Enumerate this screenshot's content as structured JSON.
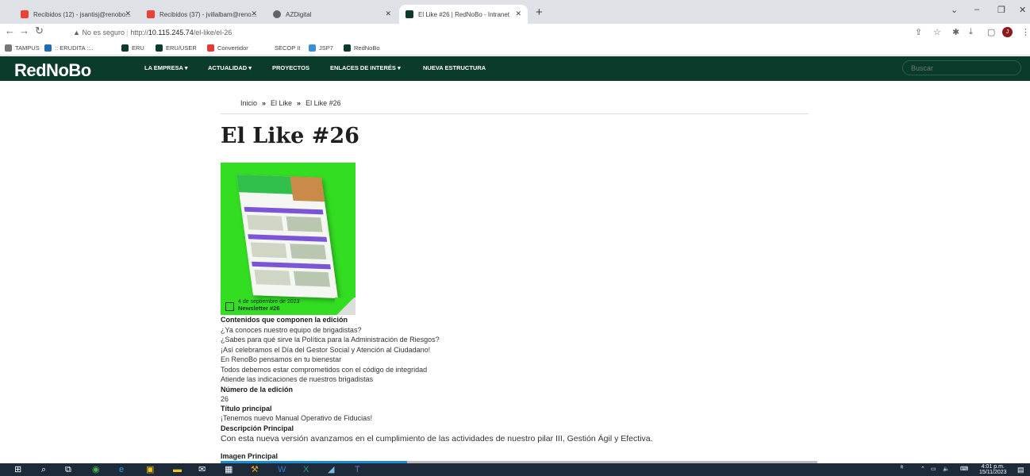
{
  "browser": {
    "tabs": [
      {
        "title": "Recibidos (12) - jsantisj@renobo...",
        "icon": "gmail-icon",
        "active": false
      },
      {
        "title": "Recibidos (37) - jvillalbam@reno...",
        "icon": "gmail-icon",
        "active": false
      },
      {
        "title": "AZDigital",
        "icon": "globe-icon",
        "active": false
      },
      {
        "title": "El Like #26 | RedNoBo - Intranet",
        "icon": "site-icon",
        "active": true
      }
    ],
    "new_tab": "+",
    "security_label": "No es seguro",
    "url_prefix": "http://",
    "url_host": "10.115.245.74",
    "url_path": "/el-like/el-26",
    "bookmarks": [
      "TAMPUS",
      ":: ERUDITA ::..",
      "ERU",
      "ERU/USER",
      "Convertidor",
      "SECOP II",
      "JSP7",
      "RedNoBo"
    ]
  },
  "site": {
    "logo": "RedNoBo",
    "menu": [
      "LA EMPRESA ▾",
      "ACTUALIDAD ▾",
      "PROYECTOS",
      "ENLACES DE INTERÉS ▾",
      "NUEVA ESTRUCTURA"
    ],
    "search_placeholder": "Buscar"
  },
  "breadcrumb": {
    "items": [
      "Inicio",
      "El Like",
      "El Like #26"
    ],
    "sep": "»"
  },
  "page": {
    "title": "El Like #26",
    "image_caption_date": "4 de septiembre de 2023",
    "image_caption_title": "Newsletter #26",
    "contents_heading": "Contenidos que componen la edición",
    "contents": [
      "¿Ya conoces nuestro equipo de brigadistas?",
      "¿Sabes para qué sirve la Política para la Administración de Riesgos?",
      "¡Así celebramos el Día del Gestor Social y Atención al Ciudadano!",
      "En RenoBo pensamos en tu bienestar",
      "Todos debemos estar comprometidos con el código de integridad",
      "Atiende las indicaciones de nuestros brigadistas"
    ],
    "edition_heading": "Número de la edición",
    "edition_value": "26",
    "main_title_heading": "Título principal",
    "main_title_value": "¡Tenemos nuevo Manual Operativo de Fiducias!",
    "description_heading": "Descripción Principal",
    "description_value": "Con esta nueva versión avanzamos en el cumplimiento de las actividades de nuestro pilar III, Gestión Ágil y Efectiva.",
    "main_image_heading": "Imagen Principal"
  },
  "taskbar": {
    "time": "4:01 p.m.",
    "date": "15/11/2023"
  },
  "colors": {
    "nav_bg": "#0b3b2b",
    "accent_green": "#33dd22",
    "tab_bg": "#dee1e6"
  }
}
